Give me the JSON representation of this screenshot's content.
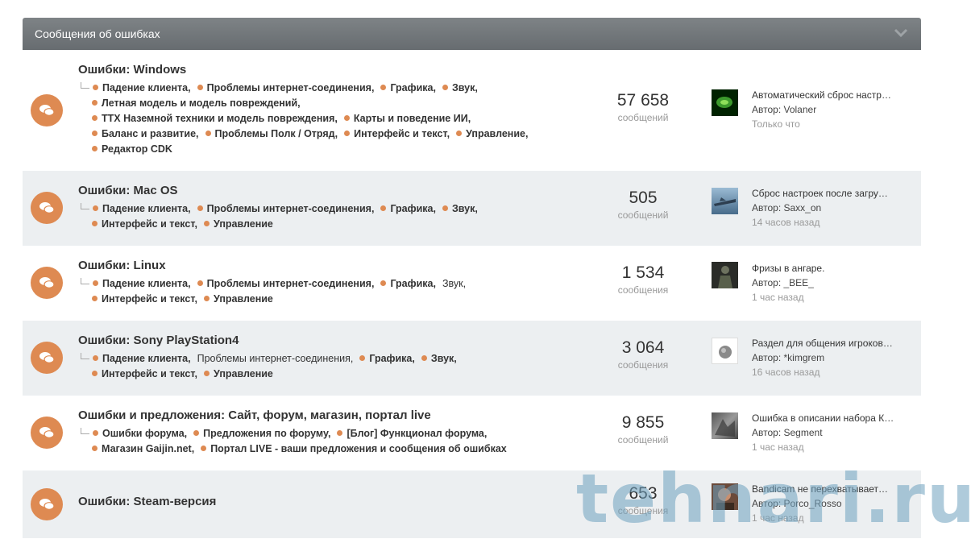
{
  "category": {
    "title": "Сообщения об ошибках",
    "chevron_icon": "chevron-down-icon"
  },
  "forums": [
    {
      "title": "Ошибки: Windows",
      "subforum_lines": [
        [
          {
            "label": "Падение клиента,",
            "state": "new"
          },
          {
            "label": "Проблемы интернет-соединения,",
            "state": "new"
          },
          {
            "label": "Графика,",
            "state": "new"
          },
          {
            "label": "Звук,",
            "state": "new"
          }
        ],
        [
          {
            "label": "Летная модель и модель повреждений,",
            "state": "new"
          }
        ],
        [
          {
            "label": "ТТХ Наземной техники и модель повреждения,",
            "state": "new"
          },
          {
            "label": "Карты и поведение ИИ,",
            "state": "new"
          }
        ],
        [
          {
            "label": "Баланс и развитие,",
            "state": "new"
          },
          {
            "label": "Проблемы Полк / Отряд,",
            "state": "new"
          },
          {
            "label": "Интерфейс и текст,",
            "state": "new"
          },
          {
            "label": "Управление,",
            "state": "new"
          }
        ],
        [
          {
            "label": "Редактор CDK",
            "state": "new"
          }
        ]
      ],
      "count": "57 658",
      "count_label": "сообщений",
      "last_title": "Автоматический сброс настр…",
      "last_author": "Автор: Volaner",
      "last_time": "Только что"
    },
    {
      "title": "Ошибки: Mac OS",
      "subforum_lines": [
        [
          {
            "label": "Падение клиента,",
            "state": "new"
          },
          {
            "label": "Проблемы интернет-соединения,",
            "state": "new"
          },
          {
            "label": "Графика,",
            "state": "new"
          },
          {
            "label": "Звук,",
            "state": "new"
          }
        ],
        [
          {
            "label": "Интерфейс и текст,",
            "state": "new"
          },
          {
            "label": "Управление",
            "state": "new"
          }
        ]
      ],
      "count": "505",
      "count_label": "сообщений",
      "last_title": "Сброс настроек после загру…",
      "last_author": "Автор: Saxx_on",
      "last_time": "14 часов назад"
    },
    {
      "title": "Ошибки: Linux",
      "subforum_lines": [
        [
          {
            "label": "Падение клиента,",
            "state": "new"
          },
          {
            "label": "Проблемы интернет-соединения,",
            "state": "new"
          },
          {
            "label": "Графика,",
            "state": "new"
          },
          {
            "label": "Звук,",
            "state": "read"
          }
        ],
        [
          {
            "label": "Интерфейс и текст,",
            "state": "new"
          },
          {
            "label": "Управление",
            "state": "new"
          }
        ]
      ],
      "count": "1 534",
      "count_label": "сообщения",
      "last_title": "Фризы в ангаре.",
      "last_author": "Автор: _BEE_",
      "last_time": "1 час назад"
    },
    {
      "title": "Ошибки: Sony PlayStation4",
      "subforum_lines": [
        [
          {
            "label": "Падение клиента,",
            "state": "new"
          },
          {
            "label": "Проблемы интернет-соединения,",
            "state": "read"
          },
          {
            "label": "Графика,",
            "state": "new"
          },
          {
            "label": "Звук,",
            "state": "new"
          }
        ],
        [
          {
            "label": "Интерфейс и текст,",
            "state": "new"
          },
          {
            "label": "Управление",
            "state": "new"
          }
        ]
      ],
      "count": "3 064",
      "count_label": "сообщения",
      "last_title": "Раздел для общения игроков…",
      "last_author": "Автор: *kimgrem",
      "last_time": "16 часов назад"
    },
    {
      "title": "Ошибки и предложения: Сайт, форум, магазин, портал live",
      "subforum_lines": [
        [
          {
            "label": "Ошибки форума,",
            "state": "new"
          },
          {
            "label": "Предложения по форуму,",
            "state": "new"
          },
          {
            "label": "[Блог] Функционал форума,",
            "state": "new"
          }
        ],
        [
          {
            "label": "Магазин Gaijin.net,",
            "state": "new"
          },
          {
            "label": "Портал LIVE - ваши предложения и сообщения об ошибках",
            "state": "new"
          }
        ]
      ],
      "count": "9 855",
      "count_label": "сообщений",
      "last_title": "Ошибка в описании набора К…",
      "last_author": "Автор: Segment",
      "last_time": "1 час назад"
    },
    {
      "title": "Ошибки: Steam-версия",
      "subforum_lines": [],
      "count": "653",
      "count_label": "сообщения",
      "last_title": "Bandicam не перехватывает…",
      "last_author": "Автор: Porco_Rosso",
      "last_time": "1 час назад"
    }
  ],
  "watermark": "tehnari.ru",
  "colors": {
    "accent": "#de8a52",
    "header": "#72777a",
    "alt_row": "#eceff1"
  }
}
